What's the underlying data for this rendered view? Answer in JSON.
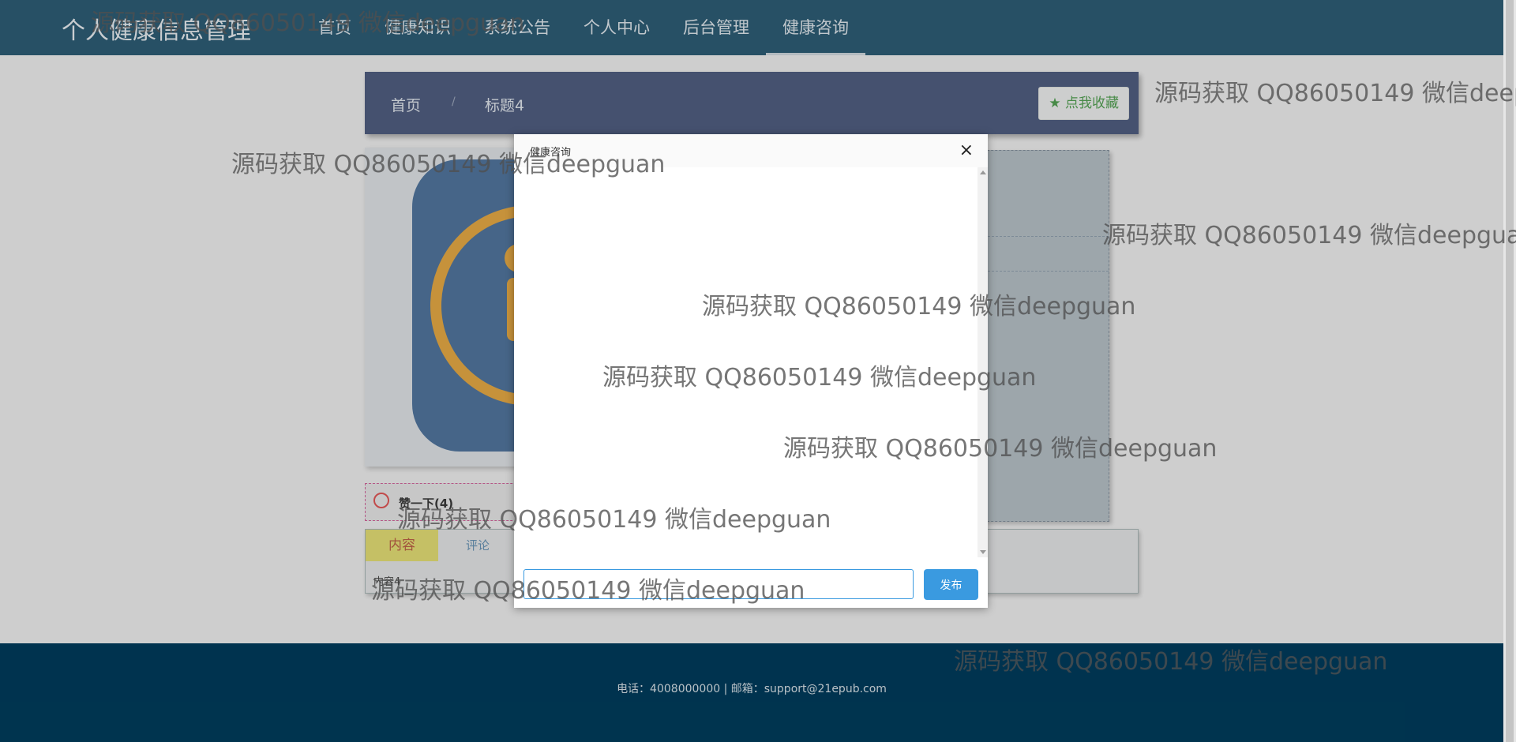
{
  "header": {
    "brand": "个人健康信息管理",
    "nav": [
      "首页",
      "健康知识",
      "系统公告",
      "个人中心",
      "后台管理",
      "健康咨询"
    ],
    "active_nav": "健康咨询"
  },
  "breadcrumb": {
    "items": [
      "首页",
      "标题4"
    ],
    "separator": "/",
    "favorite_label": "点我收藏"
  },
  "like": {
    "label": "赞一下(4)"
  },
  "tabs": {
    "items": [
      "内容",
      "评论"
    ],
    "active": "内容",
    "content_text": "内容4"
  },
  "dialog": {
    "title": "健康咨询",
    "close_symbol": "×",
    "input_value": "",
    "publish_label": "发布"
  },
  "footer": {
    "text": "电话：4008000000 | 邮箱：support@21epub.com"
  },
  "watermark": "源码获取 QQ86050149 微信deepguan",
  "colors": {
    "topbar": "#003b5a",
    "breadcrumb_bar": "#2b3d67",
    "accent": "#3a9ae0",
    "favorite_green": "#2f8f2f",
    "active_tab": "#e3dc5a"
  }
}
